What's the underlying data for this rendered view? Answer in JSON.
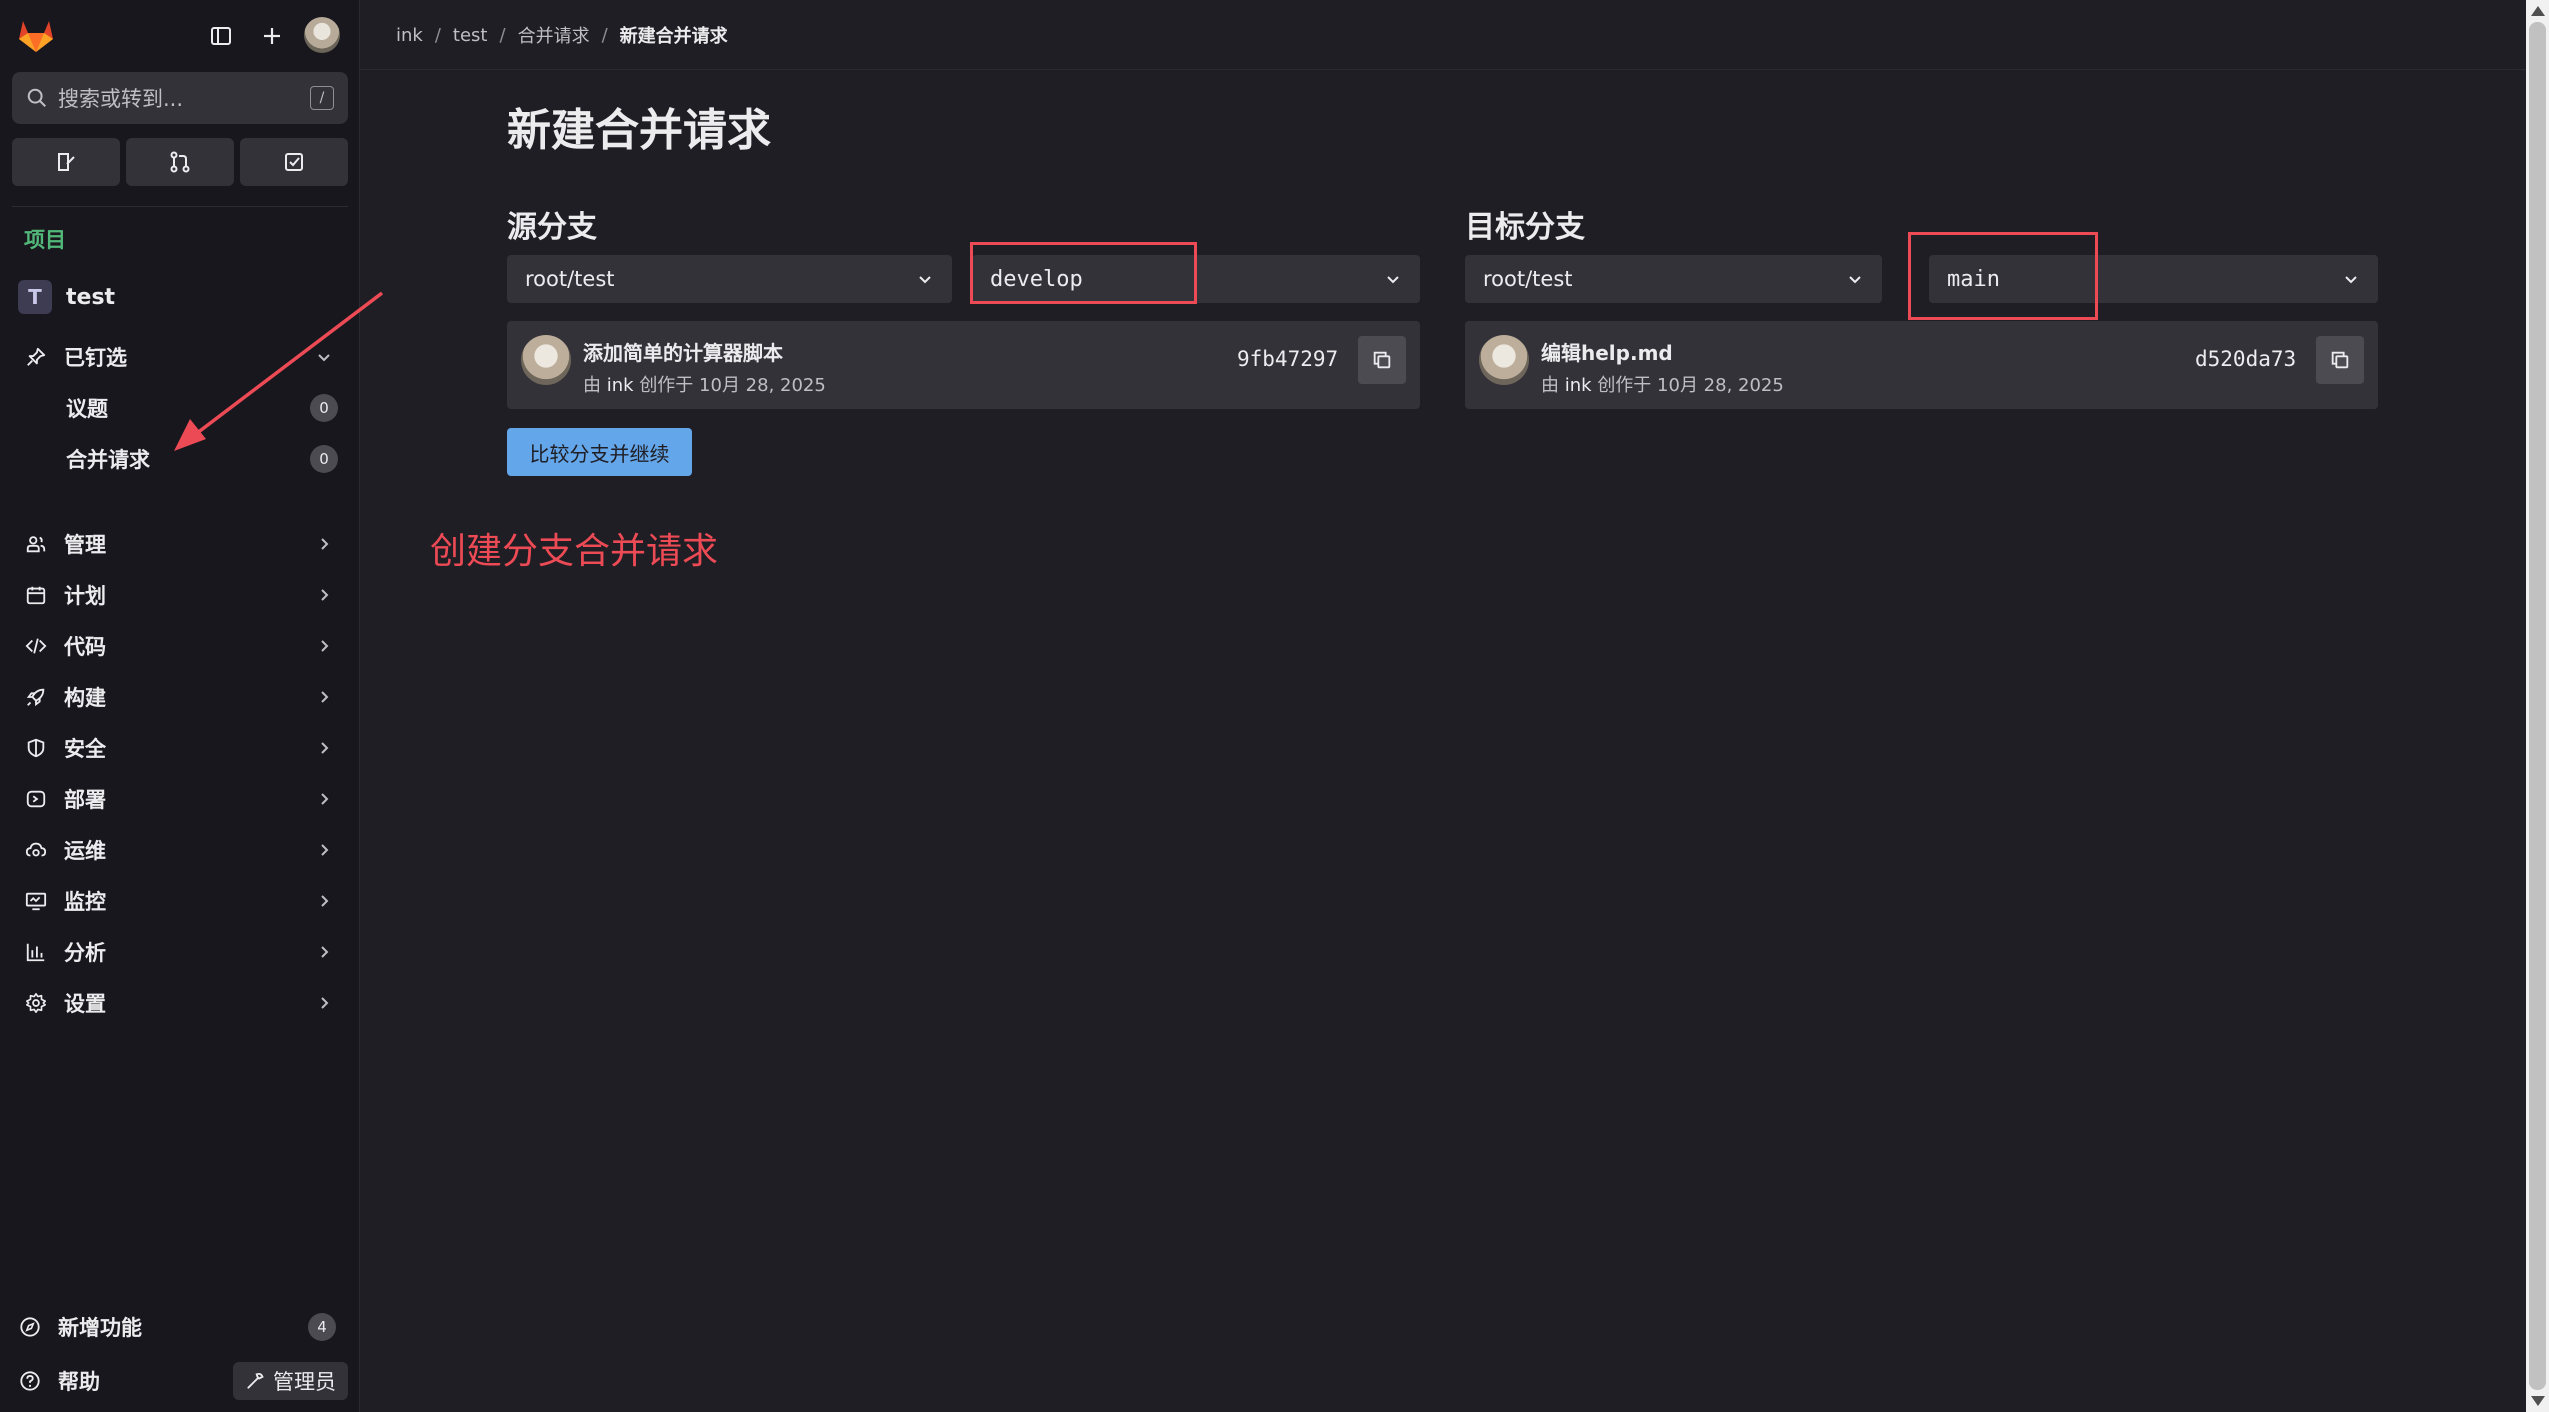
{
  "sidebar": {
    "search_placeholder": "搜索或转到...",
    "search_shortcut": "/",
    "section_label": "项目",
    "project": {
      "initial": "T",
      "name": "test"
    },
    "pinned": {
      "label": "已钉选",
      "items": [
        {
          "label": "议题",
          "count": "0"
        },
        {
          "label": "合并请求",
          "count": "0"
        }
      ]
    },
    "nav": [
      {
        "label": "管理",
        "icon": "users-icon"
      },
      {
        "label": "计划",
        "icon": "calendar-icon"
      },
      {
        "label": "代码",
        "icon": "code-icon"
      },
      {
        "label": "构建",
        "icon": "rocket-icon"
      },
      {
        "label": "安全",
        "icon": "shield-icon"
      },
      {
        "label": "部署",
        "icon": "deploy-icon"
      },
      {
        "label": "运维",
        "icon": "cloud-gear-icon"
      },
      {
        "label": "监控",
        "icon": "monitor-icon"
      },
      {
        "label": "分析",
        "icon": "chart-icon"
      },
      {
        "label": "设置",
        "icon": "gear-icon"
      }
    ],
    "whats_new": {
      "label": "新增功能",
      "count": "4"
    },
    "help": {
      "label": "帮助"
    },
    "admin": {
      "label": "管理员"
    }
  },
  "breadcrumb": [
    "ink",
    "test",
    "合并请求",
    "新建合并请求"
  ],
  "page": {
    "title": "新建合并请求",
    "source": {
      "heading": "源分支",
      "project": "root/test",
      "branch": "develop",
      "commit": {
        "title": "添加简单的计算器脚本",
        "by": "由",
        "author": "ink",
        "created": "创作于 10月 28, 2025",
        "sha": "9fb47297"
      }
    },
    "target": {
      "heading": "目标分支",
      "project": "root/test",
      "branch": "main",
      "commit": {
        "title": "编辑help.md",
        "by": "由",
        "author": "ink",
        "created": "创作于 10月 28, 2025",
        "sha": "d520da73"
      }
    },
    "compare_button": "比较分支并继续"
  },
  "annotation": {
    "text": "创建分支合并请求",
    "color": "#ec4a55"
  },
  "colors": {
    "accent": "#63a6e9",
    "bg": "#1f1e24",
    "sidebar": "#18171d",
    "annotation": "#ec4a55"
  }
}
